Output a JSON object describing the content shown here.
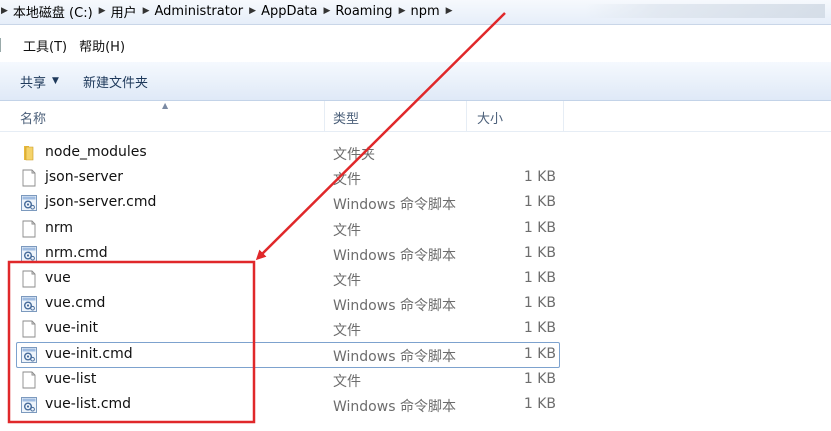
{
  "address": {
    "crumbs": [
      "本地磁盘 (C:)",
      "用户",
      "Administrator",
      "AppData",
      "Roaming",
      "npm"
    ]
  },
  "menubar": {
    "items": [
      "工具(T)",
      "帮助(H)"
    ]
  },
  "toolbar": {
    "share_label": "共享",
    "new_folder_label": "新建文件夹"
  },
  "columns": {
    "name": "名称",
    "type": "类型",
    "size": "大小"
  },
  "files": [
    {
      "name": "node_modules",
      "type": "文件夹",
      "size": "",
      "icon": "folder-icon"
    },
    {
      "name": "json-server",
      "type": "文件",
      "size": "1 KB",
      "icon": "file-icon"
    },
    {
      "name": "json-server.cmd",
      "type": "Windows 命令脚本",
      "size": "1 KB",
      "icon": "cmd-script-icon"
    },
    {
      "name": "nrm",
      "type": "文件",
      "size": "1 KB",
      "icon": "file-icon"
    },
    {
      "name": "nrm.cmd",
      "type": "Windows 命令脚本",
      "size": "1 KB",
      "icon": "cmd-script-icon"
    },
    {
      "name": "vue",
      "type": "文件",
      "size": "1 KB",
      "icon": "file-icon"
    },
    {
      "name": "vue.cmd",
      "type": "Windows 命令脚本",
      "size": "1 KB",
      "icon": "cmd-script-icon"
    },
    {
      "name": "vue-init",
      "type": "文件",
      "size": "1 KB",
      "icon": "file-icon"
    },
    {
      "name": "vue-init.cmd",
      "type": "Windows 命令脚本",
      "size": "1 KB",
      "icon": "cmd-script-icon"
    },
    {
      "name": "vue-list",
      "type": "文件",
      "size": "1 KB",
      "icon": "file-icon"
    },
    {
      "name": "vue-list.cmd",
      "type": "Windows 命令脚本",
      "size": "1 KB",
      "icon": "cmd-script-icon"
    }
  ],
  "selected_file": "vue-init.cmd",
  "annotation": {
    "color": "#e0282a",
    "highlighted_files": [
      "vue",
      "vue.cmd",
      "vue-init",
      "vue-init.cmd",
      "vue-list",
      "vue-list.cmd"
    ]
  }
}
